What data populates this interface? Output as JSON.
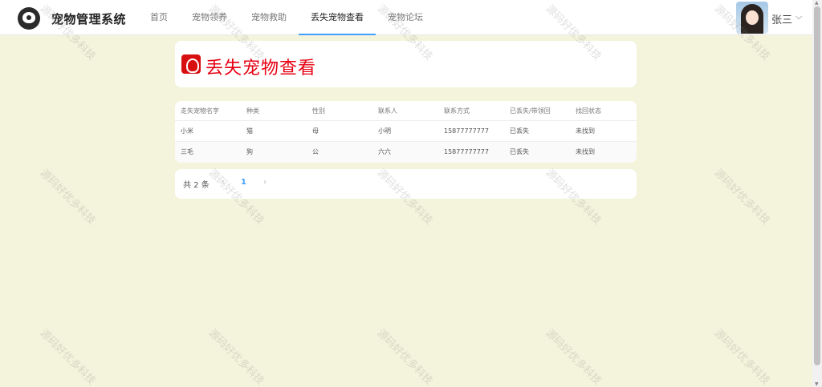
{
  "header": {
    "brand": "宠物管理系统",
    "nav": [
      "首页",
      "宠物领养",
      "宠物救助",
      "丢失宠物查看",
      "宠物论坛"
    ],
    "active_index": 3,
    "username": "张三",
    "chevron": "⌵"
  },
  "title_card": {
    "title": "丢失宠物查看",
    "icon": "pet-paw-icon"
  },
  "table": {
    "columns": [
      "走失宠物名字",
      "种类",
      "性别",
      "联系人",
      "联系方式",
      "已丢失/带领回",
      "找回状态"
    ],
    "rows": [
      [
        "小米",
        "猫",
        "母",
        "小明",
        "15877777777",
        "已丢失",
        "未找到"
      ],
      [
        "三毛",
        "狗",
        "公",
        "六六",
        "15877777777",
        "已丢失",
        "未找到"
      ]
    ]
  },
  "pagination": {
    "total": "共 2 条",
    "prev": "‹",
    "current_page": "1",
    "next": "›"
  },
  "watermark": "源码好优多科技",
  "colors": {
    "background": "#f4f4dc",
    "accent": "#409eff",
    "title_red": "#e60012"
  }
}
